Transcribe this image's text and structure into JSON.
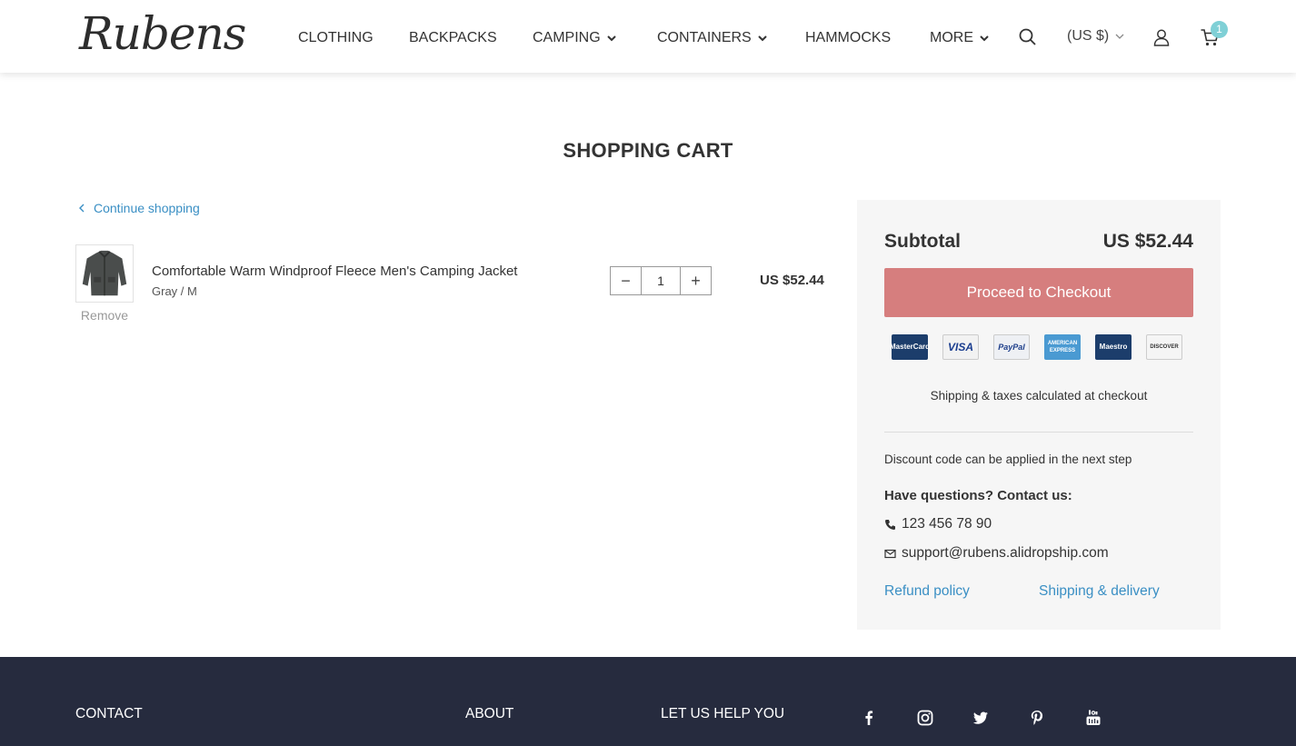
{
  "header": {
    "logo": "Rubens",
    "nav": [
      "CLOTHING",
      "BACKPACKS",
      "CAMPING",
      "CONTAINERS",
      "HAMMOCKS",
      "MORE"
    ],
    "currency": "(US $)",
    "cart_count": "1"
  },
  "page": {
    "title": "SHOPPING CART",
    "continue": "Continue shopping"
  },
  "cart": {
    "item": {
      "name": "Comfortable Warm Windproof Fleece Men's Camping Jacket",
      "variant": "Gray / M",
      "remove": "Remove",
      "quantity": "1",
      "minus": "−",
      "plus": "+",
      "price": "US $52.44"
    }
  },
  "summary": {
    "subtotal_label": "Subtotal",
    "subtotal_value": "US $52.44",
    "checkout": "Proceed to Checkout",
    "cards": [
      "MasterCard",
      "VISA",
      "PayPal",
      "AMERICAN EXPRESS",
      "Maestro",
      "DISCOVER"
    ],
    "shipping_note": "Shipping & taxes calculated at checkout",
    "discount_note": "Discount code can be applied in the next step",
    "questions": "Have questions? Contact us:",
    "phone": "123 456 78 90",
    "email": "support@rubens.alidropship.com",
    "refund": "Refund policy",
    "shipping_link": "Shipping & delivery"
  },
  "footer": {
    "headings": [
      "CONTACT",
      "ABOUT",
      "LET US HELP YOU"
    ]
  },
  "colors": {
    "accent_link": "#3a8fc4",
    "checkout_button": "#d67e7e",
    "badge": "#7fd0d6",
    "footer_bg": "#262b3e"
  }
}
